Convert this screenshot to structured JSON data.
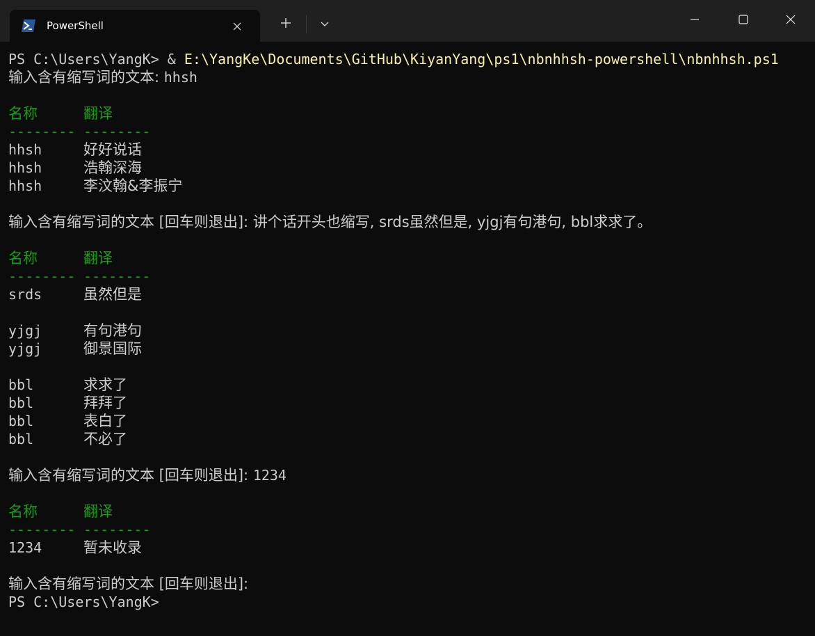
{
  "window": {
    "tab_title": "PowerShell",
    "new_tab_symbol": "+",
    "icons": {
      "tab_icon": "powershell-icon",
      "close": "close-icon",
      "new_tab": "plus-icon",
      "dropdown": "chevron-down-icon",
      "minimize": "minimize-icon",
      "maximize": "maximize-icon",
      "window_close": "window-close-icon"
    }
  },
  "colors": {
    "background": "#0c0c0c",
    "text": "#cccccc",
    "header_green": "#13a10e",
    "command_yellow": "#f9f1a5",
    "titlebar": "#202020"
  },
  "terminal": {
    "prompt_1": "PS C:\\Users\\YangK> ",
    "command_operator": "& ",
    "command_path": "E:\\YangKe\\Documents\\GitHub\\KiyanYang\\ps1\\nbnhhsh-powershell\\nbnhhsh.ps1",
    "prompt_input_1_label": "输入含有缩写词的文本: ",
    "prompt_input_1_value": "hhsh",
    "header_name": "名称",
    "header_translation": "翻译",
    "header_rule_name": "--------",
    "header_rule_translation": "--------",
    "block_1": [
      {
        "name": "hhsh",
        "translation": "好好说话"
      },
      {
        "name": "hhsh",
        "translation": "浩翰深海"
      },
      {
        "name": "hhsh",
        "translation": "李汶翰&李振宁"
      }
    ],
    "prompt_input_2_label": "输入含有缩写词的文本 [回车则退出]: ",
    "prompt_input_2_value": "讲个话开头也缩写, srds虽然但是, yjgj有句港句, bbl求求了。",
    "block_2_group_1": [
      {
        "name": "srds",
        "translation": "虽然但是"
      }
    ],
    "block_2_group_2": [
      {
        "name": "yjgj",
        "translation": "有句港句"
      },
      {
        "name": "yjgj",
        "translation": "御景国际"
      }
    ],
    "block_2_group_3": [
      {
        "name": "bbl",
        "translation": "求求了"
      },
      {
        "name": "bbl",
        "translation": "拜拜了"
      },
      {
        "name": "bbl",
        "translation": "表白了"
      },
      {
        "name": "bbl",
        "translation": "不必了"
      }
    ],
    "prompt_input_3_label": "输入含有缩写词的文本 [回车则退出]: ",
    "prompt_input_3_value": "1234",
    "block_3": [
      {
        "name": "1234",
        "translation": "暂未收录"
      }
    ],
    "prompt_input_4_label": "输入含有缩写词的文本 [回车则退出]:",
    "prompt_final": "PS C:\\Users\\YangK>"
  }
}
